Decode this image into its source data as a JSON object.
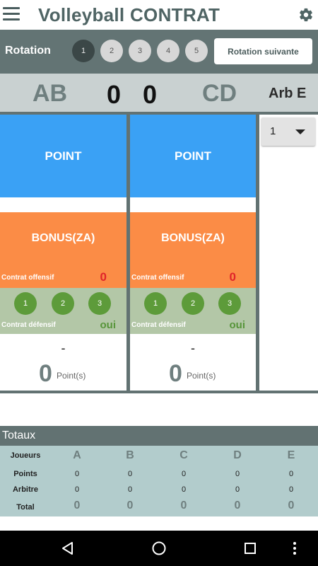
{
  "app": {
    "title": "Volleyball CONTRAT"
  },
  "rotation": {
    "label": "Rotation",
    "circles": [
      "1",
      "2",
      "3",
      "4",
      "5"
    ],
    "active": "1",
    "next_button": "Rotation suivante"
  },
  "score": {
    "team_left": "AB",
    "score_left": "0",
    "score_right": "0",
    "team_right": "CD",
    "arbitre": "Arb E"
  },
  "columns": [
    {
      "point_label": "POINT",
      "bonus_label": "BONUS(ZA)",
      "contrat_offensif_label": "Contrat offensif",
      "contrat_offensif_value": "0",
      "numbers": [
        "1",
        "2",
        "3"
      ],
      "contrat_defensif_label": "Contrat défensif",
      "contrat_defensif_value": "oui",
      "dash": "-",
      "points_value": "0",
      "points_label": "Point(s)"
    },
    {
      "point_label": "POINT",
      "bonus_label": "BONUS(ZA)",
      "contrat_offensif_label": "Contrat offensif",
      "contrat_offensif_value": "0",
      "numbers": [
        "1",
        "2",
        "3"
      ],
      "contrat_defensif_label": "Contrat défensif",
      "contrat_defensif_value": "oui",
      "dash": "-",
      "points_value": "0",
      "points_label": "Point(s)"
    }
  ],
  "selector": {
    "value": "1"
  },
  "totals": {
    "title": "Totaux",
    "header_label": "Joueurs",
    "players": [
      "A",
      "B",
      "C",
      "D",
      "E"
    ],
    "rows": [
      {
        "label": "Points",
        "values": [
          "0",
          "0",
          "0",
          "0",
          "0"
        ]
      },
      {
        "label": "Arbitre",
        "values": [
          "0",
          "0",
          "0",
          "0",
          "0"
        ]
      },
      {
        "label": "Total",
        "values": [
          "0",
          "0",
          "0",
          "0",
          "0"
        ]
      }
    ]
  },
  "icons": {
    "menu": "menu-icon",
    "settings": "gear-icon",
    "dropdown": "chevron-down-icon",
    "nav_back": "back-triangle-icon",
    "nav_home": "home-circle-icon",
    "nav_recent": "recent-square-icon",
    "nav_more": "more-vertical-icon"
  },
  "colors": {
    "point": "#3aa1f5",
    "bonus": "#fb8c46",
    "defensif": "#b3c7a7",
    "numbers": "#5d9b3a",
    "offensif_value": "#e0242a",
    "bar": "#637474"
  }
}
